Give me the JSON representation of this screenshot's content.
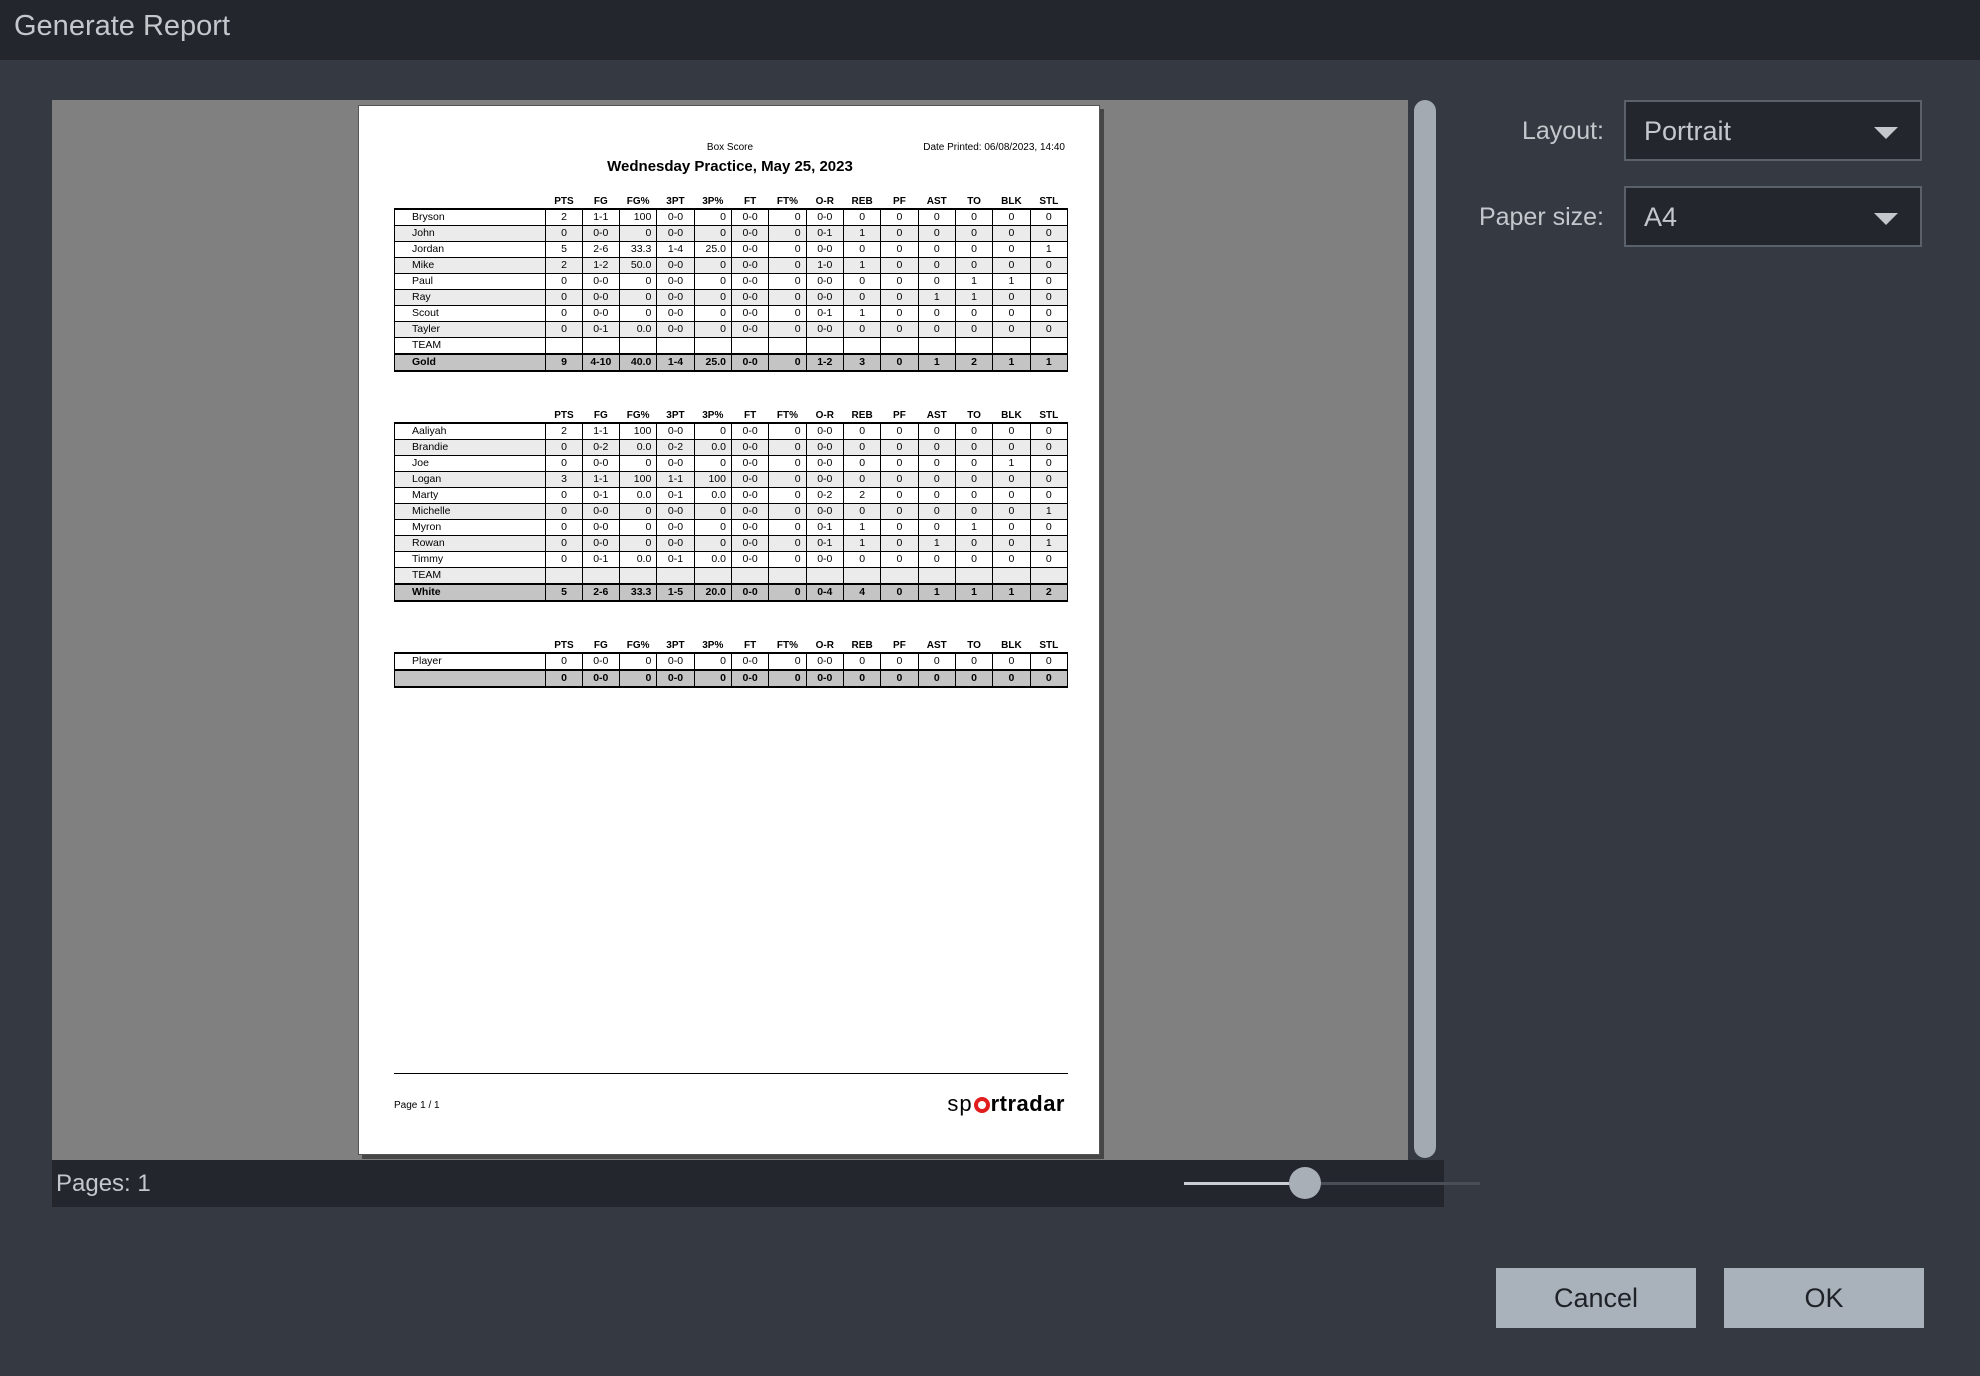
{
  "window": {
    "title": "Generate Report"
  },
  "report": {
    "subtitle": "Box Score",
    "date_printed": "Date Printed: 06/08/2023, 14:40",
    "title": "Wednesday Practice, May 25, 2023",
    "page_label": "Page 1 / 1",
    "logo": {
      "pre": "sp",
      "post": "rtradar"
    },
    "columns": [
      "PTS",
      "FG",
      "FG%",
      "3PT",
      "3P%",
      "FT",
      "FT%",
      "O-R",
      "REB",
      "PF",
      "AST",
      "TO",
      "BLK",
      "STL"
    ],
    "teams": [
      {
        "rows": [
          [
            "Bryson",
            "2",
            "1-1",
            "100",
            "0-0",
            "0",
            "0-0",
            "0",
            "0-0",
            "0",
            "0",
            "0",
            "0",
            "0",
            "0"
          ],
          [
            "John",
            "0",
            "0-0",
            "0",
            "0-0",
            "0",
            "0-0",
            "0",
            "0-1",
            "1",
            "0",
            "0",
            "0",
            "0",
            "0"
          ],
          [
            "Jordan",
            "5",
            "2-6",
            "33.3",
            "1-4",
            "25.0",
            "0-0",
            "0",
            "0-0",
            "0",
            "0",
            "0",
            "0",
            "0",
            "1"
          ],
          [
            "Mike",
            "2",
            "1-2",
            "50.0",
            "0-0",
            "0",
            "0-0",
            "0",
            "1-0",
            "1",
            "0",
            "0",
            "0",
            "0",
            "0"
          ],
          [
            "Paul",
            "0",
            "0-0",
            "0",
            "0-0",
            "0",
            "0-0",
            "0",
            "0-0",
            "0",
            "0",
            "0",
            "1",
            "1",
            "0"
          ],
          [
            "Ray",
            "0",
            "0-0",
            "0",
            "0-0",
            "0",
            "0-0",
            "0",
            "0-0",
            "0",
            "0",
            "1",
            "1",
            "0",
            "0"
          ],
          [
            "Scout",
            "0",
            "0-0",
            "0",
            "0-0",
            "0",
            "0-0",
            "0",
            "0-1",
            "1",
            "0",
            "0",
            "0",
            "0",
            "0"
          ],
          [
            "Tayler",
            "0",
            "0-1",
            "0.0",
            "0-0",
            "0",
            "0-0",
            "0",
            "0-0",
            "0",
            "0",
            "0",
            "0",
            "0",
            "0"
          ],
          [
            "TEAM",
            "",
            "",
            "",
            "",
            "",
            "",
            "",
            "",
            "",
            "",
            "",
            "",
            "",
            ""
          ]
        ],
        "total": [
          "Gold",
          "9",
          "4-10",
          "40.0",
          "1-4",
          "25.0",
          "0-0",
          "0",
          "1-2",
          "3",
          "0",
          "1",
          "2",
          "1",
          "1"
        ]
      },
      {
        "rows": [
          [
            "Aaliyah",
            "2",
            "1-1",
            "100",
            "0-0",
            "0",
            "0-0",
            "0",
            "0-0",
            "0",
            "0",
            "0",
            "0",
            "0",
            "0"
          ],
          [
            "Brandie",
            "0",
            "0-2",
            "0.0",
            "0-2",
            "0.0",
            "0-0",
            "0",
            "0-0",
            "0",
            "0",
            "0",
            "0",
            "0",
            "0"
          ],
          [
            "Joe",
            "0",
            "0-0",
            "0",
            "0-0",
            "0",
            "0-0",
            "0",
            "0-0",
            "0",
            "0",
            "0",
            "0",
            "1",
            "0"
          ],
          [
            "Logan",
            "3",
            "1-1",
            "100",
            "1-1",
            "100",
            "0-0",
            "0",
            "0-0",
            "0",
            "0",
            "0",
            "0",
            "0",
            "0"
          ],
          [
            "Marty",
            "0",
            "0-1",
            "0.0",
            "0-1",
            "0.0",
            "0-0",
            "0",
            "0-2",
            "2",
            "0",
            "0",
            "0",
            "0",
            "0"
          ],
          [
            "Michelle",
            "0",
            "0-0",
            "0",
            "0-0",
            "0",
            "0-0",
            "0",
            "0-0",
            "0",
            "0",
            "0",
            "0",
            "0",
            "1"
          ],
          [
            "Myron",
            "0",
            "0-0",
            "0",
            "0-0",
            "0",
            "0-0",
            "0",
            "0-1",
            "1",
            "0",
            "0",
            "1",
            "0",
            "0"
          ],
          [
            "Rowan",
            "0",
            "0-0",
            "0",
            "0-0",
            "0",
            "0-0",
            "0",
            "0-1",
            "1",
            "0",
            "1",
            "0",
            "0",
            "1"
          ],
          [
            "Timmy",
            "0",
            "0-1",
            "0.0",
            "0-1",
            "0.0",
            "0-0",
            "0",
            "0-0",
            "0",
            "0",
            "0",
            "0",
            "0",
            "0"
          ],
          [
            "TEAM",
            "",
            "",
            "",
            "",
            "",
            "",
            "",
            "",
            "",
            "",
            "",
            "",
            "",
            ""
          ]
        ],
        "total": [
          "White",
          "5",
          "2-6",
          "33.3",
          "1-5",
          "20.0",
          "0-0",
          "0",
          "0-4",
          "4",
          "0",
          "1",
          "1",
          "1",
          "2"
        ]
      },
      {
        "rows": [
          [
            "Player",
            "0",
            "0-0",
            "0",
            "0-0",
            "0",
            "0-0",
            "0",
            "0-0",
            "0",
            "0",
            "0",
            "0",
            "0",
            "0"
          ]
        ],
        "total": [
          "",
          "0",
          "0-0",
          "0",
          "0-0",
          "0",
          "0-0",
          "0",
          "0-0",
          "0",
          "0",
          "0",
          "0",
          "0",
          "0"
        ]
      }
    ]
  },
  "status": {
    "pages_label": "Pages: 1",
    "zoom_level": 0.41
  },
  "settings": {
    "layout_label": "Layout:",
    "layout_value": "Portrait",
    "paper_label": "Paper size:",
    "paper_value": "A4"
  },
  "buttons": {
    "cancel": "Cancel",
    "ok": "OK"
  }
}
